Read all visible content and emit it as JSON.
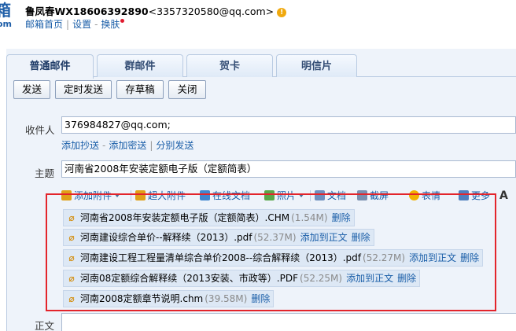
{
  "header": {
    "logo_char": "箱",
    "logo_sub": "om",
    "user_name": "鲁凤春WX18606392890",
    "user_email": "<3357320580@qq.com>",
    "warn_symbol": "!",
    "nav": [
      "邮箱首页",
      "设置",
      "换肤"
    ]
  },
  "tabs": [
    "普通邮件",
    "群邮件",
    "贺卡",
    "明信片"
  ],
  "actions": [
    "发送",
    "定时发送",
    "存草稿",
    "关闭"
  ],
  "compose": {
    "to_label": "收件人",
    "to_value": "376984827@qq.com;",
    "to_links": [
      "添加抄送",
      "添加密送",
      "分别发送"
    ],
    "subject_label": "主题",
    "subject_value": "河南省2008年安装定额电子版（定额简表）",
    "body_label": "正文"
  },
  "toolbar": [
    "添加附件",
    "超大附件",
    "在线文档",
    "照片",
    "文档",
    "截屏",
    "表情",
    "更多",
    "A"
  ],
  "attachments": [
    {
      "name": "河南省2008年安装定额电子版（定额简表）.CHM",
      "size": "(1.54M)",
      "links": [
        "删除"
      ]
    },
    {
      "name": "河南建设综合单价--解释续（2013）.pdf",
      "size": "(52.37M)",
      "links": [
        "添加到正文",
        "删除"
      ]
    },
    {
      "name": "河南建设工程工程量清单综合单价2008--综合解释续（2013）.pdf",
      "size": "(52.27M)",
      "links": [
        "添加到正文",
        "删除"
      ]
    },
    {
      "name": "河南08定额综合解释续（2013安装、市政等）.PDF",
      "size": "(52.25M)",
      "links": [
        "添加到正文",
        "删除"
      ]
    },
    {
      "name": "河南2008定额章节说明.chm",
      "size": "(39.58M)",
      "links": [
        "删除"
      ]
    }
  ],
  "colors": {
    "link": "#1a5ea8",
    "highlight_border": "#e3242b",
    "panel_bg": "#eef3fa",
    "attachment_bg": "#dde8f5"
  }
}
